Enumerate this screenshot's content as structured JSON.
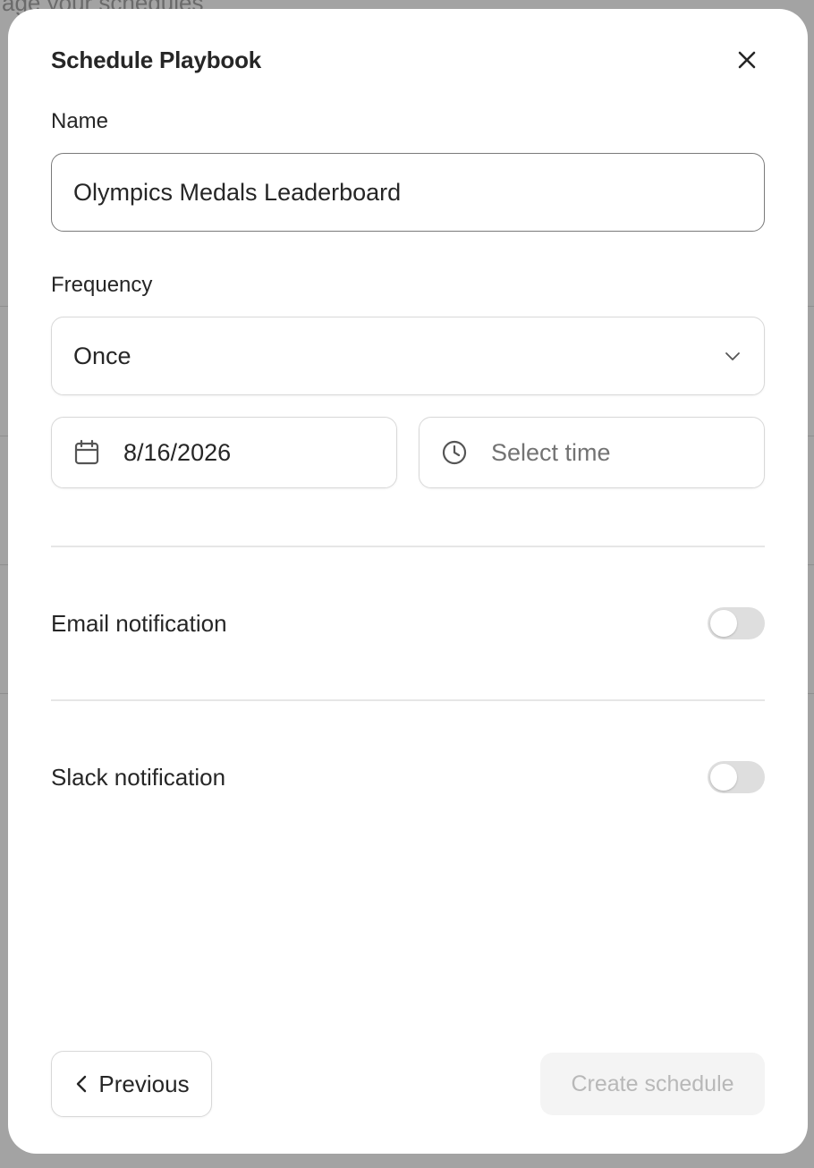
{
  "background": {
    "subtitle": "age your schedules"
  },
  "modal": {
    "title": "Schedule Playbook",
    "close_icon": "close-icon",
    "name_label": "Name",
    "name_value": "Olympics Medals Leaderboard",
    "frequency_label": "Frequency",
    "frequency_value": "Once",
    "date_value": "8/16/2026",
    "time_placeholder": "Select time",
    "email_label": "Email notification",
    "email_enabled": false,
    "slack_label": "Slack notification",
    "slack_enabled": false,
    "previous_label": "Previous",
    "create_label": "Create schedule"
  },
  "icons": {
    "close": "close-icon",
    "chevron": "chevron-down-icon",
    "calendar": "calendar-icon",
    "clock": "clock-icon",
    "back": "chevron-left-icon"
  },
  "colors": {
    "overlay": "#a3a3a3",
    "text": "#262626",
    "toggle_off": "#dedede",
    "disabled_bg": "#f4f4f4",
    "disabled_text": "#b8b8b8"
  }
}
